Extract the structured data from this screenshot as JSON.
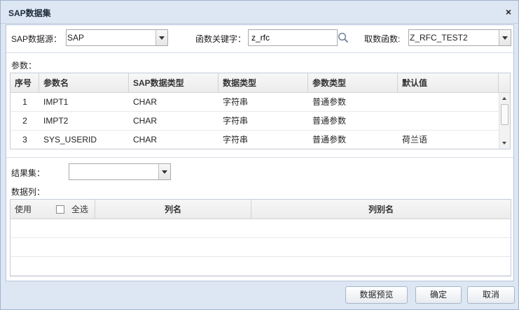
{
  "dialog": {
    "title": "SAP数据集",
    "close_glyph": "×"
  },
  "source": {
    "label": "SAP数据源：",
    "value": "SAP"
  },
  "keyword": {
    "label": "函数关键字：",
    "value": "z_rfc"
  },
  "func": {
    "label": "取数函数:",
    "value": "Z_RFC_TEST2"
  },
  "params": {
    "label": "参数：",
    "columns": [
      "序号",
      "参数名",
      "SAP数据类型",
      "数据类型",
      "参数类型",
      "默认值"
    ],
    "rows": [
      {
        "index": "1",
        "name": "IMPT1",
        "sap_type": "CHAR",
        "data_type": "字符串",
        "param_type": "普通参数",
        "default": ""
      },
      {
        "index": "2",
        "name": "IMPT2",
        "sap_type": "CHAR",
        "data_type": "字符串",
        "param_type": "普通参数",
        "default": ""
      },
      {
        "index": "3",
        "name": "SYS_USERID",
        "sap_type": "CHAR",
        "data_type": "字符串",
        "param_type": "普通参数",
        "default": "荷兰语"
      }
    ]
  },
  "resultset": {
    "label": "结果集：",
    "value": ""
  },
  "datacols": {
    "label": "数据列：",
    "col_use": "使用",
    "col_selectall": "全选",
    "col_name": "列名",
    "col_alias": "列别名"
  },
  "buttons": {
    "preview": "数据预览",
    "ok": "确定",
    "cancel": "取消"
  }
}
